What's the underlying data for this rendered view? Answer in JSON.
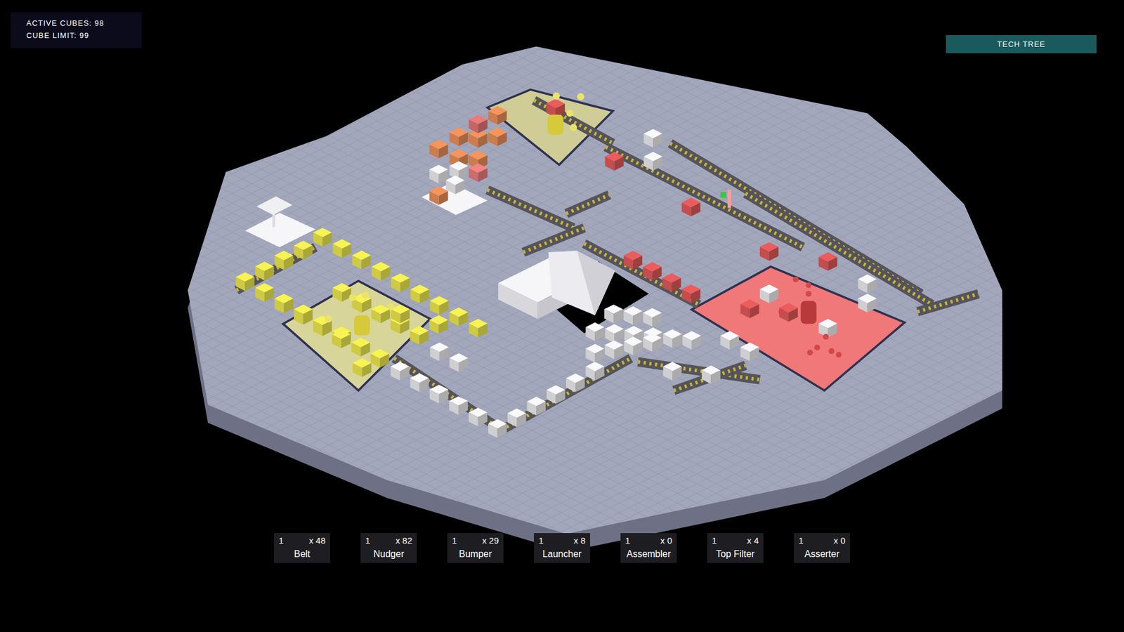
{
  "hud": {
    "active_cubes": "ACTIVE CUBES: 98",
    "cube_limit": "CUBE LIMIT: 99"
  },
  "tech_tree_button": {
    "label": "TECH TREE"
  },
  "toolbar": [
    {
      "hotkey": "1",
      "count": "x 48",
      "label": "Belt"
    },
    {
      "hotkey": "1",
      "count": "x 82",
      "label": "Nudger"
    },
    {
      "hotkey": "1",
      "count": "x 29",
      "label": "Bumper"
    },
    {
      "hotkey": "1",
      "count": "x 8",
      "label": "Launcher"
    },
    {
      "hotkey": "1",
      "count": "x 0",
      "label": "Assembler"
    },
    {
      "hotkey": "1",
      "count": "x 4",
      "label": "Top Filter"
    },
    {
      "hotkey": "1",
      "count": "x 0",
      "label": "Asserter"
    }
  ]
}
